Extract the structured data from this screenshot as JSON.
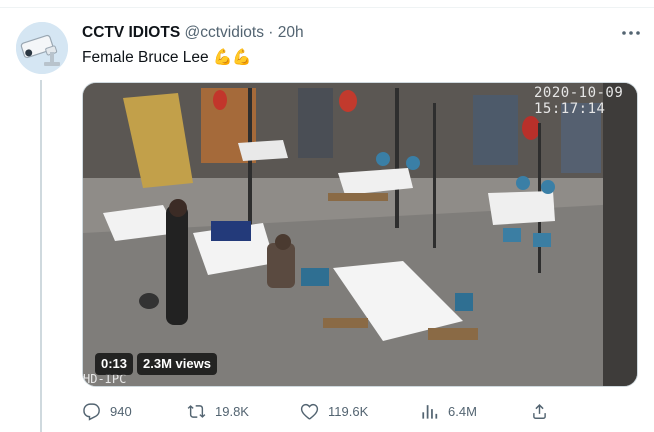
{
  "tweet": {
    "author_name": "CCTV IDIOTS",
    "handle": "@cctvidiots",
    "separator": "·",
    "time": "20h",
    "text": "Female Bruce Lee 💪💪"
  },
  "media": {
    "video_timestamp": "2020-10-09 15:17:14",
    "overlay_text": "HD-IPC",
    "duration": "0:13",
    "views": "2.3M views"
  },
  "actions": {
    "replies": "940",
    "retweets": "19.8K",
    "likes": "119.6K",
    "views": "6.4M"
  },
  "icons": [
    "cctv-avatar-icon",
    "more-icon",
    "reply-icon",
    "retweet-icon",
    "like-icon",
    "views-icon",
    "share-icon"
  ]
}
